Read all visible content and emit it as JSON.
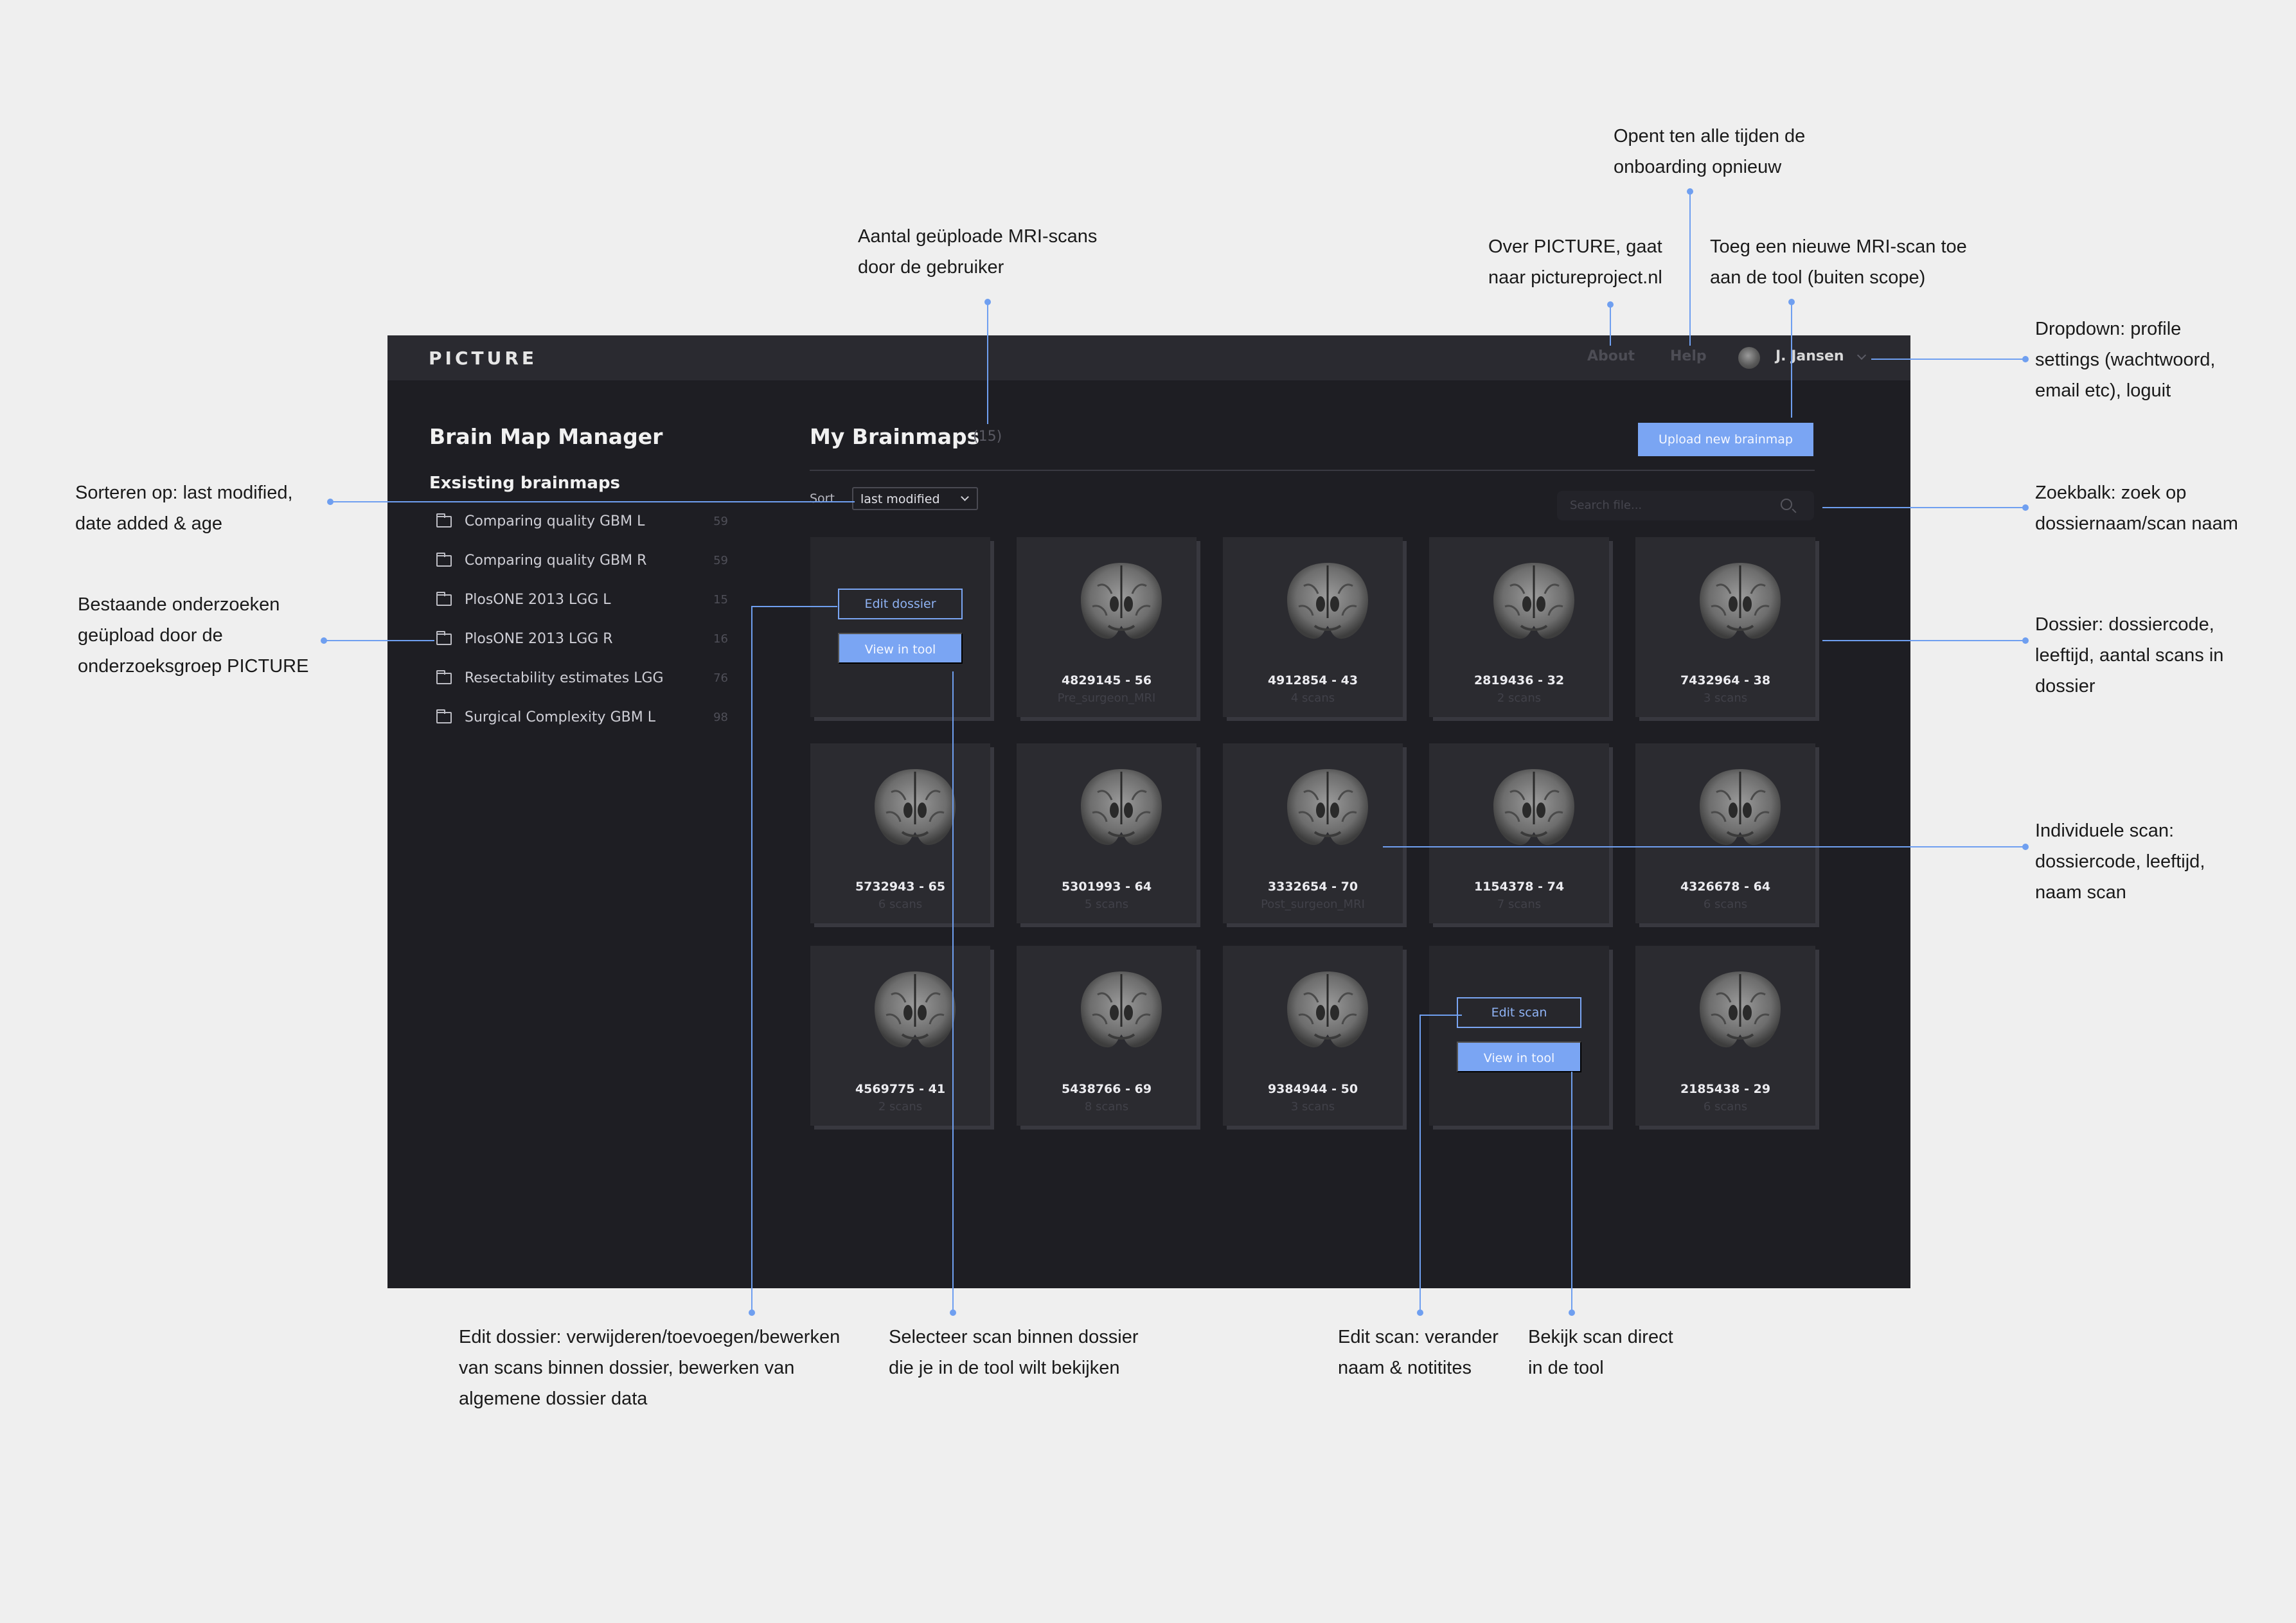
{
  "header": {
    "logo": "PICTURE",
    "about": "About",
    "help": "Help",
    "user_name": "J. Jansen"
  },
  "sidebar": {
    "title": "Brain Map Manager",
    "subtitle": "Exsisting brainmaps",
    "items": [
      {
        "label": "Comparing quality GBM L",
        "count": "59"
      },
      {
        "label": "Comparing quality GBM R",
        "count": "59"
      },
      {
        "label": "PlosONE 2013 LGG L",
        "count": "15"
      },
      {
        "label": "PlosONE 2013 LGG R",
        "count": "16"
      },
      {
        "label": "Resectability estimates LGG",
        "count": "76"
      },
      {
        "label": "Surgical Complexity GBM L",
        "count": "98"
      }
    ]
  },
  "main": {
    "title": "My Brainmaps",
    "count": "(15)",
    "upload_label": "Upload new brainmap",
    "sort_label": "Sort",
    "sort_value": "last modified",
    "search_placeholder": "Search file...",
    "edit_dossier_label": "Edit dossier",
    "edit_scan_label": "Edit scan",
    "view_in_tool_label": "View in tool",
    "cards": [
      {
        "title": "",
        "sub": ""
      },
      {
        "title": "4829145 - 56",
        "sub": "Pre_surgeon_MRI"
      },
      {
        "title": "4912854 - 43",
        "sub": "4 scans"
      },
      {
        "title": "2819436 - 32",
        "sub": "2 scans"
      },
      {
        "title": "7432964 - 38",
        "sub": "3 scans"
      },
      {
        "title": "5732943 - 65",
        "sub": "6 scans"
      },
      {
        "title": "5301993 - 64",
        "sub": "5 scans"
      },
      {
        "title": "3332654 - 70",
        "sub": "Post_surgeon_MRI"
      },
      {
        "title": "1154378 - 74",
        "sub": "7 scans"
      },
      {
        "title": "4326678 - 64",
        "sub": "6 scans"
      },
      {
        "title": "4569775 - 41",
        "sub": "2 scans"
      },
      {
        "title": "5438766 - 69",
        "sub": "8 scans"
      },
      {
        "title": "9384944 - 50",
        "sub": "3 scans"
      },
      {
        "title": "",
        "sub": ""
      },
      {
        "title": "2185438 - 29",
        "sub": "6 scans"
      }
    ]
  },
  "annotations": {
    "onboarding": "Opent ten alle tijden de\nonboarding opnieuw",
    "scan_count": "Aantal geüploade MRI-scans\ndoor de gebruiker",
    "about": "Over PICTURE, gaat\nnaar pictureproject.nl",
    "upload": "Toeg een nieuwe MRI-scan toe\naan de tool (buiten scope)",
    "dropdown": "Dropdown: profile\nsettings (wachtwoord,\nemail etc), loguit",
    "sort": "Sorteren op: last modified,\ndate added & age",
    "search": "Zoekbalk: zoek op\ndossiernaam/scan naam",
    "existing": "Bestaande onderzoeken\ngeüpload door de\nonderzoeksgroep PICTURE",
    "dossier": "Dossier: dossiercode,\nleeftijd, aantal scans in\ndossier",
    "scan": "Individuele scan:\ndossiercode, leeftijd,\nnaam scan",
    "edit_dossier": "Edit dossier: verwijderen/toevoegen/bewerken\nvan scans binnen dossier, bewerken van\nalgemene dossier data",
    "select_scan": "Selecteer scan binnen dossier\ndie je in de tool wilt bekijken",
    "edit_scan": "Edit scan: verander\nnaam & notitites",
    "view_scan": "Bekijk scan direct\nin de tool"
  },
  "colors": {
    "accent": "#7aa5f3",
    "app_bg": "#1e1e23",
    "topbar_bg": "#2a2a30",
    "card_bg": "#2b2b30",
    "canvas_bg": "#efefef"
  }
}
